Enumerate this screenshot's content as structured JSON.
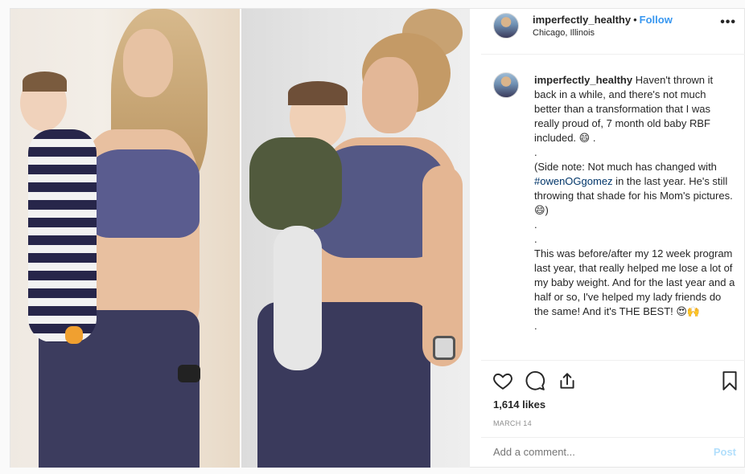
{
  "header": {
    "username": "imperfectly_healthy",
    "separator": "•",
    "follow_label": "Follow",
    "location": "Chicago, Illinois",
    "more_label": "•••"
  },
  "caption": {
    "username": "imperfectly_healthy",
    "line1": "Haven't thrown it back in a while, and there's not much better than a transformation that I was really proud of, 7 month old baby RBF included. 😄 .",
    "dot1": ".",
    "line2_prefix": "(Side note: Not much has changed with ",
    "hashtag": "#owenOGgomez",
    "line2_suffix": " in the last year. He's still throwing that shade for his Mom's pictures. 😄)",
    "dot2": ".",
    "dot3": ".",
    "line3": "This was before/after my 12 week program last year, that really helped me lose a lot of my baby weight. And for the last year and a half or so, I've helped my lady friends do the same! And it's THE BEST! 😍🙌",
    "dot4": "."
  },
  "actions": {
    "like_icon": "heart-icon",
    "comment_icon": "comment-icon",
    "share_icon": "share-icon",
    "save_icon": "bookmark-icon"
  },
  "likes": "1,614 likes",
  "date": "MARCH 14",
  "comment": {
    "placeholder": "Add a comment...",
    "post_label": "Post"
  },
  "colors": {
    "link_blue": "#3897f0",
    "hashtag_blue": "#003569",
    "muted_gray": "#8e8e8e",
    "post_disabled": "#b2dffc"
  }
}
